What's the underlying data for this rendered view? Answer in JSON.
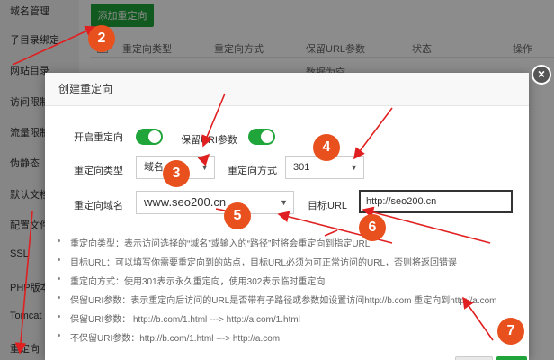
{
  "sidebar": {
    "items": [
      "域名管理",
      "子目录绑定",
      "网站目录",
      "访问限制",
      "流量限制",
      "伪静态",
      "默认文档",
      "配置文件",
      "SSL",
      "PHP版本",
      "Tomcat",
      "重定向"
    ]
  },
  "toolbar": {
    "add_label": "添加重定向"
  },
  "table": {
    "headers": [
      "重定向类型",
      "重定向方式",
      "保留URL参数",
      "状态",
      "操作"
    ],
    "empty_text": "数据为空"
  },
  "dialog": {
    "title": "创建重定向",
    "close_glyph": "×",
    "enable_label": "开启重定向",
    "keep_params_label": "保留URI参数",
    "type_label": "重定向类型",
    "type_value": "域名",
    "method_label": "重定向方式",
    "method_value": "301",
    "domain_label": "重定向域名",
    "domain_value": "www.seo200.cn",
    "target_label": "目标URL",
    "target_value": "http://seo200.cn",
    "notes": [
      "重定向类型：表示访问选择的“域名”或输入的“路径”时将会重定向到指定URL",
      "目标URL：可以填写你需要重定向到的站点，目标URL必须为可正常访问的URL，否则将返回错误",
      "重定向方式：使用301表示永久重定向，使用302表示临时重定向",
      "保留URI参数：表示重定向后访问的URL是否带有子路径或参数如设置访问http://b.com 重定向到http://a.com",
      "保留URI参数：  http://b.com/1.html ---> http://a.com/1.html",
      "不保留URI参数：http://b.com/1.html ---> http://a.com"
    ],
    "toggles": {
      "enable_on": true,
      "keep_params_on": true
    }
  },
  "annotations": [
    "2",
    "3",
    "4",
    "5",
    "6",
    "7"
  ],
  "colors": {
    "accent": "#20a53a",
    "annotation": "#e8501d",
    "arrow": "#e02020"
  }
}
